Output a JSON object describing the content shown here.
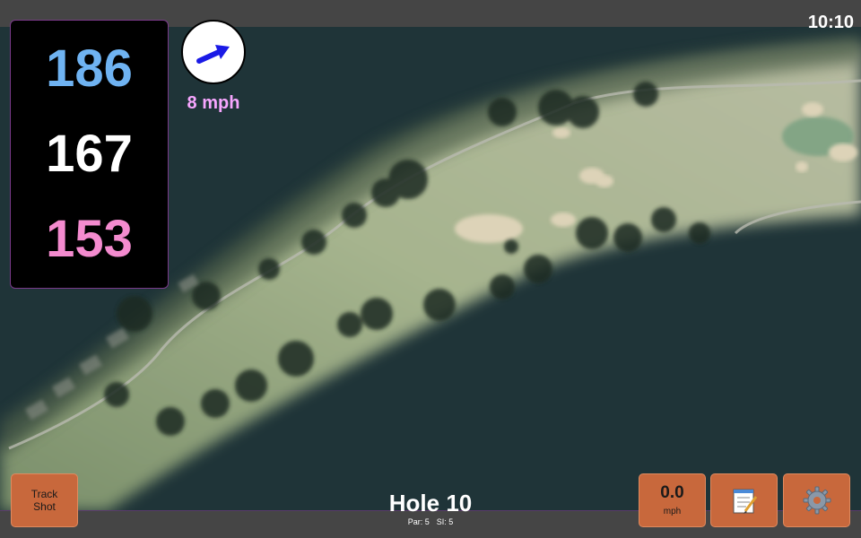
{
  "clock": "10:10",
  "distances": {
    "back": "186",
    "center": "167",
    "front": "153"
  },
  "wind": {
    "speed": "8 mph",
    "icon": "wind-direction-arrow-icon"
  },
  "buttons": {
    "track_shot": "Track Shot",
    "speed_value": "0.0",
    "speed_unit": "mph",
    "notes_icon": "notepad-icon",
    "settings_icon": "gear-icon"
  },
  "hole": {
    "title": "Hole 10",
    "par": "Par: 5",
    "si": "SI: 5"
  },
  "colors": {
    "back": "#6fb3f2",
    "center": "#ffffff",
    "front": "#f48bcf",
    "wind_arrow": "#1a1ae6",
    "button": "#c8683c"
  }
}
